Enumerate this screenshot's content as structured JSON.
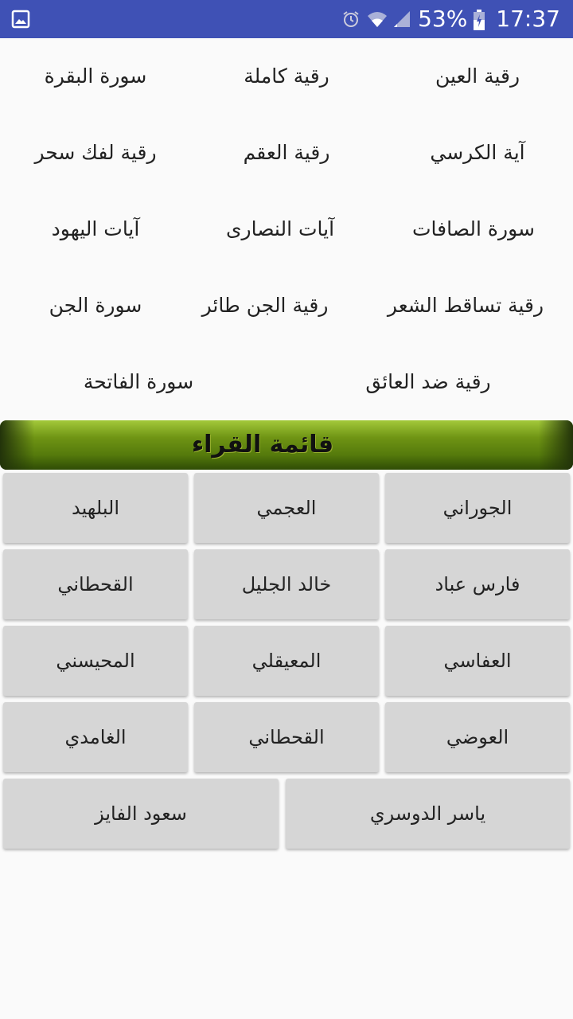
{
  "status_bar": {
    "battery_percent": "53%",
    "time": "17:37",
    "icons": [
      "gallery-icon",
      "alarm-icon",
      "wifi-icon",
      "signal-icon",
      "battery-charging-icon"
    ],
    "background_color": "#3f51b5"
  },
  "links": {
    "row1": [
      "رقية العين",
      "رقية كاملة",
      "سورة البقرة"
    ],
    "row2": [
      "آية الكرسي",
      "رقية العقم",
      "رقية لفك سحر"
    ],
    "row3": [
      "سورة الصافات",
      "آيات النصارى",
      "آيات اليهود"
    ],
    "row4": [
      "رقية تساقط الشعر",
      "رقية الجن طائر",
      "سورة الجن"
    ],
    "row5": [
      "رقية ضد العائق",
      "سورة الفاتحة"
    ]
  },
  "banner": {
    "title": "قائمة القراء",
    "color": "#6f9414"
  },
  "reciters": {
    "row1": [
      "الجوراني",
      "العجمي",
      "البلهيد"
    ],
    "row2": [
      "فارس عباد",
      "خالد الجليل",
      "القحطاني"
    ],
    "row3": [
      "العفاسي",
      "المعيقلي",
      "المحيسني"
    ],
    "row4": [
      "العوضي",
      "القحطاني",
      "الغامدي"
    ],
    "row5": [
      "ياسر الدوسري",
      "سعود الفايز"
    ]
  }
}
